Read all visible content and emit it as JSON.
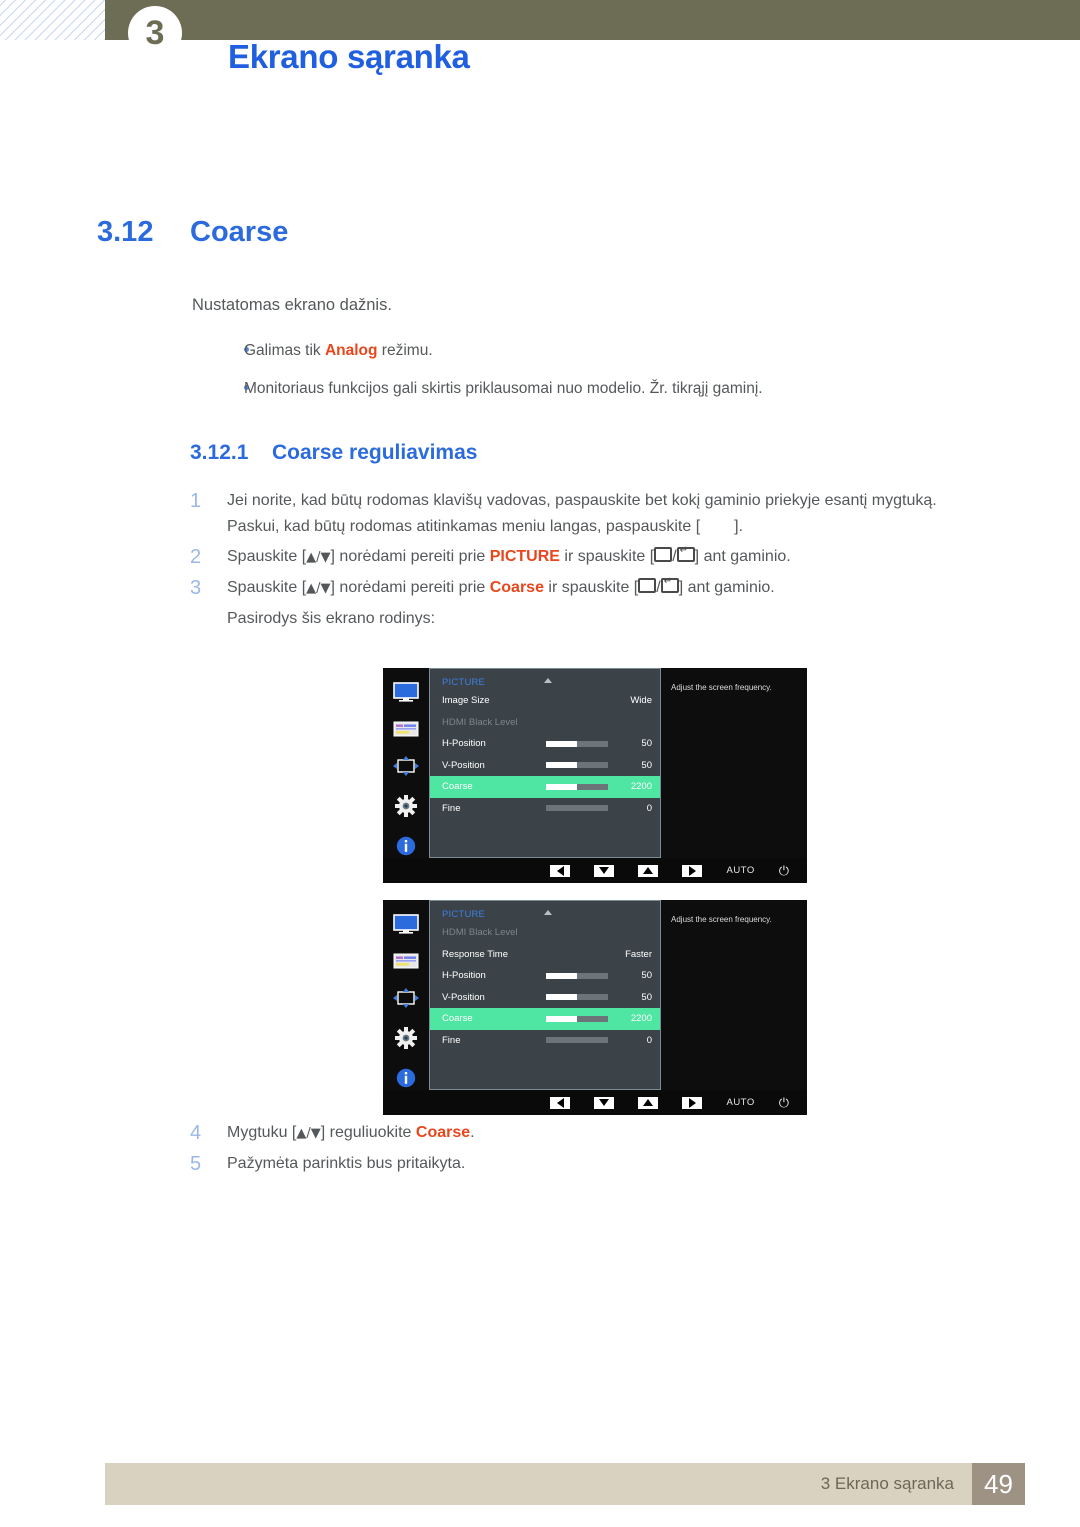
{
  "header": {
    "chapter_number": "3",
    "title": "Ekrano sąranka"
  },
  "section": {
    "number": "3.12",
    "title": "Coarse",
    "intro": "Nustatomas ekrano dažnis."
  },
  "bullets": [
    {
      "pre": "Galimas tik ",
      "kw": "Analog",
      "post": " režimu."
    },
    {
      "pre": "Monitoriaus funkcijos gali skirtis priklausomai nuo modelio. Žr. tikrąjį gaminį.",
      "kw": "",
      "post": ""
    }
  ],
  "subsection": {
    "number": "3.12.1",
    "title": "Coarse reguliavimas"
  },
  "steps": {
    "s1_num": "1",
    "s1_line1": "Jei norite, kad būtų rodomas klavišų vadovas, paspauskite bet kokį gaminio priekyje esantį mygtuką.",
    "s1_line2_a": "Paskui, kad būtų rodomas atitinkamas meniu langas, paspauskite [",
    "s1_line2_b": "].",
    "s2_num": "2",
    "s2_a": "Spauskite [",
    "s2_arrows": "▲/▼",
    "s2_b": "] norėdami pereiti prie ",
    "s2_kw": "PICTURE",
    "s2_c": " ir spauskite [",
    "s2_d": "] ant gaminio.",
    "s3_num": "3",
    "s3_a": "Spauskite [",
    "s3_arrows": "▲/▼",
    "s3_b": "] norėdami pereiti prie ",
    "s3_kw": "Coarse",
    "s3_c": " ir spauskite [",
    "s3_d": "] ant gaminio.",
    "s3_cont": "Pasirodys šis ekrano rodinys:",
    "s4_num": "4",
    "s4_a": "Mygtuku [",
    "s4_arrows": "▲/▼",
    "s4_b": "] reguliuokite ",
    "s4_kw": "Coarse",
    "s4_c": ".",
    "s5_num": "5",
    "s5_text": "Pažymėta parinktis bus pritaikyta."
  },
  "osd": {
    "title": "PICTURE",
    "help_text": "Adjust the screen frequency.",
    "controls": {
      "auto_label": "AUTO",
      "power_glyph": "⏻"
    },
    "screen1": {
      "rows": [
        {
          "label": "Image Size",
          "value": "Wide",
          "type": "word",
          "fill": 0,
          "state": "normal"
        },
        {
          "label": "HDMI Black Level",
          "value": "",
          "type": "none",
          "fill": 0,
          "state": "disabled"
        },
        {
          "label": "H-Position",
          "value": "50",
          "type": "bar",
          "fill": 50,
          "state": "normal"
        },
        {
          "label": "V-Position",
          "value": "50",
          "type": "bar",
          "fill": 50,
          "state": "normal"
        },
        {
          "label": "Coarse",
          "value": "2200",
          "type": "bar",
          "fill": 50,
          "state": "selected"
        },
        {
          "label": "Fine",
          "value": "0",
          "type": "bar",
          "fill": 0,
          "state": "normal"
        }
      ]
    },
    "screen2": {
      "rows": [
        {
          "label": "HDMI Black Level",
          "value": "",
          "type": "none",
          "fill": 0,
          "state": "disabled"
        },
        {
          "label": "Response Time",
          "value": "Faster",
          "type": "word",
          "fill": 0,
          "state": "normal"
        },
        {
          "label": "H-Position",
          "value": "50",
          "type": "bar",
          "fill": 50,
          "state": "normal"
        },
        {
          "label": "V-Position",
          "value": "50",
          "type": "bar",
          "fill": 50,
          "state": "normal"
        },
        {
          "label": "Coarse",
          "value": "2200",
          "type": "bar",
          "fill": 50,
          "state": "selected"
        },
        {
          "label": "Fine",
          "value": "0",
          "type": "bar",
          "fill": 0,
          "state": "normal"
        }
      ]
    }
  },
  "footer": {
    "text": "3 Ekrano sąranka",
    "page": "49"
  },
  "colors": {
    "heading_blue": "#2b6bdd",
    "keyword_orange": "#e8471d",
    "osd_highlight_green": "#4fe6a4",
    "top_bar_olive": "#6d6c55",
    "footer_beige": "#d9d2c0",
    "footer_page_box": "#9e9285"
  }
}
